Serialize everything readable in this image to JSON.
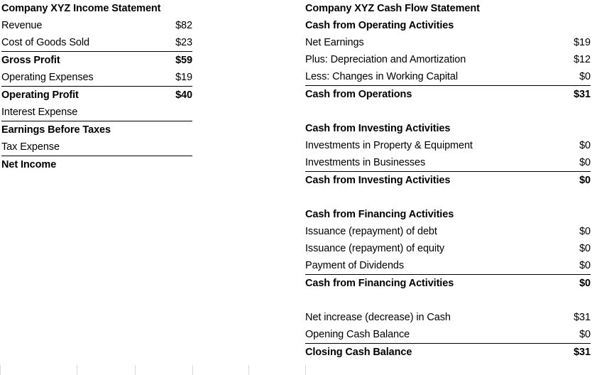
{
  "document": {
    "background_color": "#ffffff",
    "text_color": "#000000",
    "rule_color": "#000000",
    "gridline_color": "#d9d9d9"
  },
  "income_statement": {
    "title": "Company XYZ Income Statement",
    "rows": [
      {
        "label": "Revenue",
        "value": "$82",
        "bold": false,
        "ruled": false
      },
      {
        "label": "Cost of Goods Sold",
        "value": "$23",
        "bold": false,
        "ruled": false
      },
      {
        "label": "Gross Profit",
        "value": "$59",
        "bold": true,
        "ruled": true
      },
      {
        "label": "Operating Expenses",
        "value": "$19",
        "bold": false,
        "ruled": false
      },
      {
        "label": "Operating Profit",
        "value": "$40",
        "bold": true,
        "ruled": true
      },
      {
        "label": "Interest Expense",
        "value": "",
        "bold": false,
        "ruled": false
      },
      {
        "label": "Earnings Before Taxes",
        "value": "",
        "bold": true,
        "ruled": true
      },
      {
        "label": "Tax Expense",
        "value": "",
        "bold": false,
        "ruled": false
      },
      {
        "label": "Net Income",
        "value": "",
        "bold": true,
        "ruled": true
      }
    ]
  },
  "cashflow_statement": {
    "title": "Company XYZ Cash Flow Statement",
    "rows": [
      {
        "label": "Cash from Operating Activities",
        "value": "",
        "bold": true,
        "ruled": false,
        "spacer": false
      },
      {
        "label": "Net Earnings",
        "value": "$19",
        "bold": false,
        "ruled": false,
        "spacer": false
      },
      {
        "label": "Plus: Depreciation and Amortization",
        "value": "$12",
        "bold": false,
        "ruled": false,
        "spacer": false
      },
      {
        "label": "Less: Changes in Working Capital",
        "value": "$0",
        "bold": false,
        "ruled": false,
        "spacer": false
      },
      {
        "label": "Cash from Operations",
        "value": "$31",
        "bold": true,
        "ruled": true,
        "spacer": false
      },
      {
        "label": "",
        "value": "",
        "bold": false,
        "ruled": false,
        "spacer": true
      },
      {
        "label": "Cash from Investing Activities",
        "value": "",
        "bold": true,
        "ruled": false,
        "spacer": false
      },
      {
        "label": "Investments in Property & Equipment",
        "value": "$0",
        "bold": false,
        "ruled": false,
        "spacer": false
      },
      {
        "label": "Investments in Businesses",
        "value": "$0",
        "bold": false,
        "ruled": false,
        "spacer": false
      },
      {
        "label": "Cash from Investing Activities",
        "value": "$0",
        "bold": true,
        "ruled": true,
        "spacer": false
      },
      {
        "label": "",
        "value": "",
        "bold": false,
        "ruled": false,
        "spacer": true
      },
      {
        "label": "Cash from Financing Activities",
        "value": "",
        "bold": true,
        "ruled": false,
        "spacer": false
      },
      {
        "label": "Issuance (repayment) of debt",
        "value": "$0",
        "bold": false,
        "ruled": false,
        "spacer": false
      },
      {
        "label": "Issuance (repayment) of equity",
        "value": "$0",
        "bold": false,
        "ruled": false,
        "spacer": false
      },
      {
        "label": "Payment of Dividends",
        "value": "$0",
        "bold": false,
        "ruled": false,
        "spacer": false
      },
      {
        "label": "Cash from Financing Activities",
        "value": "$0",
        "bold": true,
        "ruled": true,
        "spacer": false
      },
      {
        "label": "",
        "value": "",
        "bold": false,
        "ruled": false,
        "spacer": true
      },
      {
        "label": "Net increase (decrease) in Cash",
        "value": "$31",
        "bold": false,
        "ruled": false,
        "spacer": false
      },
      {
        "label": "Opening Cash Balance",
        "value": "$0",
        "bold": false,
        "ruled": false,
        "spacer": false
      },
      {
        "label": "Closing Cash Balance",
        "value": "$31",
        "bold": true,
        "ruled": true,
        "spacer": false
      }
    ]
  },
  "column_ticks": {
    "positions": [
      0,
      108,
      190,
      271,
      350,
      430
    ]
  }
}
